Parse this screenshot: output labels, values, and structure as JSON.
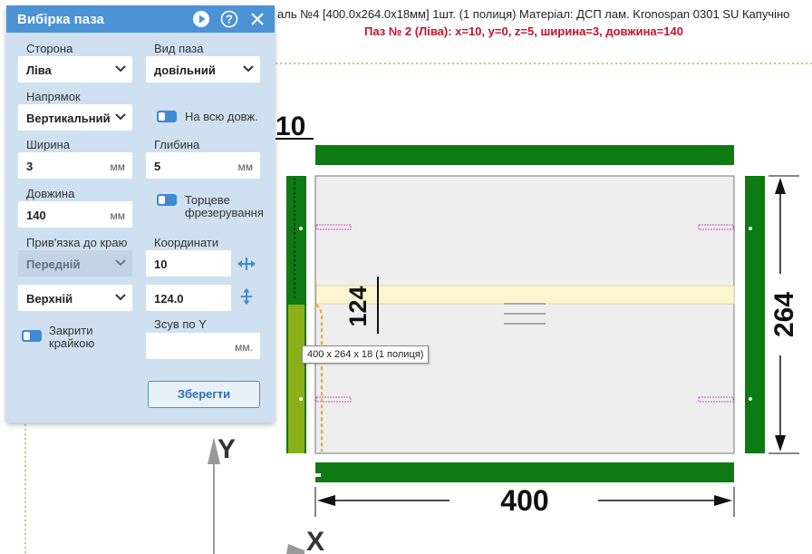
{
  "header": {
    "line1": "аль №4 [400.0x264.0x18мм] 1шт. (1 полиця) Матеріал: ДСП лам. Kronospan 0301 SU Капучіно",
    "line2": "Паз № 2 (Ліва): x=10, y=0, z=5, ширина=3, довжина=140"
  },
  "drawing": {
    "dim_top": "10",
    "dim_left": "124",
    "dim_right": "264",
    "dim_bottom": "400",
    "axis_y": "Y",
    "axis_x": "X",
    "tooltip": "400 x 264 x 18 (1 полиця)",
    "colors": {
      "edge_band": "#0e7a12",
      "groove": "#f5a623",
      "panel": "#eeeeee",
      "highlight": "#fbf6d0"
    }
  },
  "panel": {
    "title": "Вибірка паза",
    "icons": [
      "play-icon",
      "help-icon",
      "close-icon"
    ],
    "side_label": "Сторона",
    "side_value": "Ліва",
    "groove_type_label": "Вид паза",
    "groove_type_value": "довільний",
    "direction_label": "Напрямок",
    "direction_value": "Вертикальний",
    "full_length_label": "На всю довж.",
    "width_label": "Ширина",
    "width_value": "3",
    "width_unit": "мм",
    "depth_label": "Глибина",
    "depth_value": "5",
    "depth_unit": "мм",
    "length_label": "Довжина",
    "length_value": "140",
    "length_unit": "мм",
    "end_milling_label_1": "Торцеве",
    "end_milling_label_2": "фрезерування",
    "anchor_label": "Прив'язка до краю",
    "anchor_value_1": "Передній",
    "anchor_value_2": "Верхній",
    "coords_label": "Координати",
    "coord_x": "10",
    "coord_y": "124.0",
    "close_edge_label_1": "Закрити",
    "close_edge_label_2": "крайкою",
    "shift_y_label": "Зсув по Y",
    "shift_y_value": "",
    "shift_y_unit": "мм.",
    "save_label": "Зберегти"
  }
}
